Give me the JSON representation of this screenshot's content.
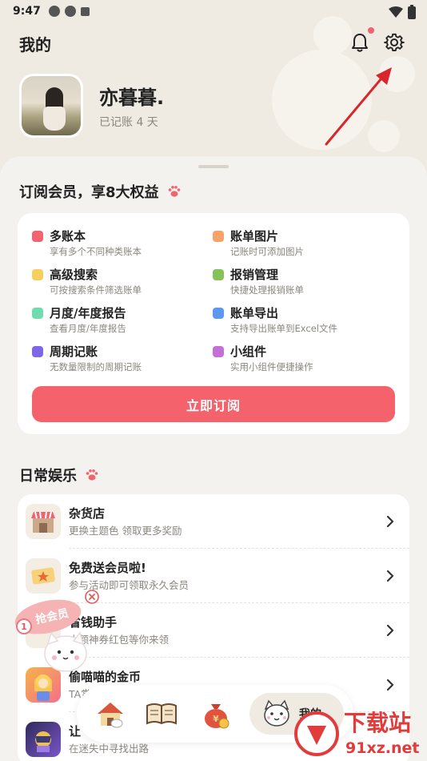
{
  "status_bar": {
    "time": "9:47"
  },
  "header": {
    "title": "我的"
  },
  "profile": {
    "nickname": "亦暮暮.",
    "days_text": "已记账 4 天"
  },
  "membership": {
    "title": "订阅会员，享8大权益",
    "features": [
      {
        "name": "多账本",
        "desc": "享有多个不同种类账本",
        "color": "#f06470"
      },
      {
        "name": "账单图片",
        "desc": "记账时可添加图片",
        "color": "#f5a26b"
      },
      {
        "name": "高级搜索",
        "desc": "可按搜索条件筛选账单",
        "color": "#f7cf5e"
      },
      {
        "name": "报销管理",
        "desc": "快捷处理报销账单",
        "color": "#86c25a"
      },
      {
        "name": "月度/年度报告",
        "desc": "查看月度/年度报告",
        "color": "#6fdcb0"
      },
      {
        "name": "账单导出",
        "desc": "支持导出账单到Excel文件",
        "color": "#5e97f0"
      },
      {
        "name": "周期记账",
        "desc": "无数量限制的周期记账",
        "color": "#7d66e8"
      },
      {
        "name": "小组件",
        "desc": "实用小组件便捷操作",
        "color": "#c56fd9"
      }
    ],
    "subscribe_label": "立即订阅"
  },
  "entertainment": {
    "title": "日常娱乐",
    "items": [
      {
        "title": "杂货店",
        "subtitle": "更换主题色 领取更多奖励"
      },
      {
        "title": "免费送会员啦!",
        "subtitle": "参与活动即可领取永久会员"
      },
      {
        "title": "省钱助手",
        "subtitle": "大额神券红包等你来领"
      },
      {
        "title": "偷喵喵的金币",
        "subtitle": "TA赏"
      },
      {
        "title": "让",
        "subtitle": "在迷失中寻找出路"
      }
    ]
  },
  "floating_badge": {
    "text": "抢会员",
    "number": "1"
  },
  "bottom_nav": {
    "active_label": "我的"
  },
  "watermark": {
    "text": "下载站",
    "domain": "91xz.net"
  }
}
